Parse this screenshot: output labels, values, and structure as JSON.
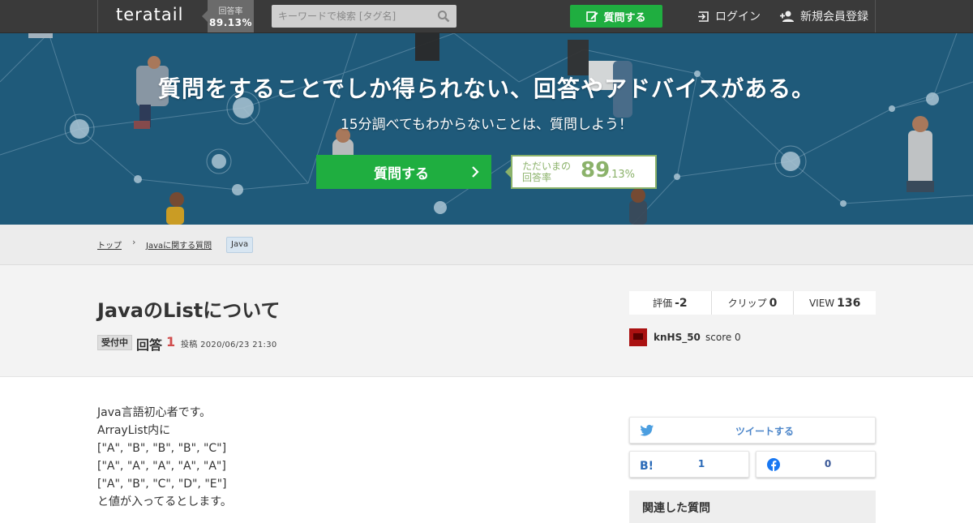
{
  "header": {
    "logo": "teratail",
    "rate_label": "回答率",
    "rate_value": "89.13%",
    "search_placeholder": "キーワードで検索 [タグ名]",
    "ask_label": "質問する",
    "login_label": "ログイン",
    "signup_label": "新規会員登録"
  },
  "hero": {
    "title": "質問をすることでしか得られない、回答やアドバイスがある。",
    "subtitle": "15分調べてもわからないことは、質問しよう！",
    "ask_label": "質問する",
    "rate_label": "ただいまの回答率",
    "rate_big": "89",
    "rate_small": ".13%"
  },
  "breadcrumb": {
    "items": [
      "トップ",
      "Javaに関する質問"
    ],
    "separator": "›",
    "tag": "Java"
  },
  "question": {
    "title": "JavaのListについて",
    "status": "受付中",
    "answers_label": "回答",
    "answers_count": "1",
    "posted": "投稿 2020/06/23 21:30",
    "stats": {
      "rating_label": "評価",
      "rating_value": "-2",
      "clip_label": "クリップ",
      "clip_value": "0",
      "view_label": "VIEW",
      "view_value": "136"
    },
    "user": {
      "name": "knHS_50",
      "score": "score 0"
    },
    "body": [
      "Java言語初心者です。",
      "ArrayList内に",
      "[\"A\", \"B\", \"B\", \"B\", \"C\"]",
      "[\"A\", \"A\", \"A\", \"A\", \"A\"]",
      "[\"A\", \"B\", \"C\", \"D\", \"E\"]",
      "と値が入ってるとします。"
    ]
  },
  "share": {
    "tweet_label": "ツイートする",
    "hatena_count": "1",
    "facebook_count": "0"
  },
  "related_title": "関連した質問",
  "colors": {
    "header_bg": "#3a3a3a",
    "hero_bg": "#1f5a7a",
    "accent_green": "#1fae40",
    "rate_green": "#8bb26a"
  }
}
